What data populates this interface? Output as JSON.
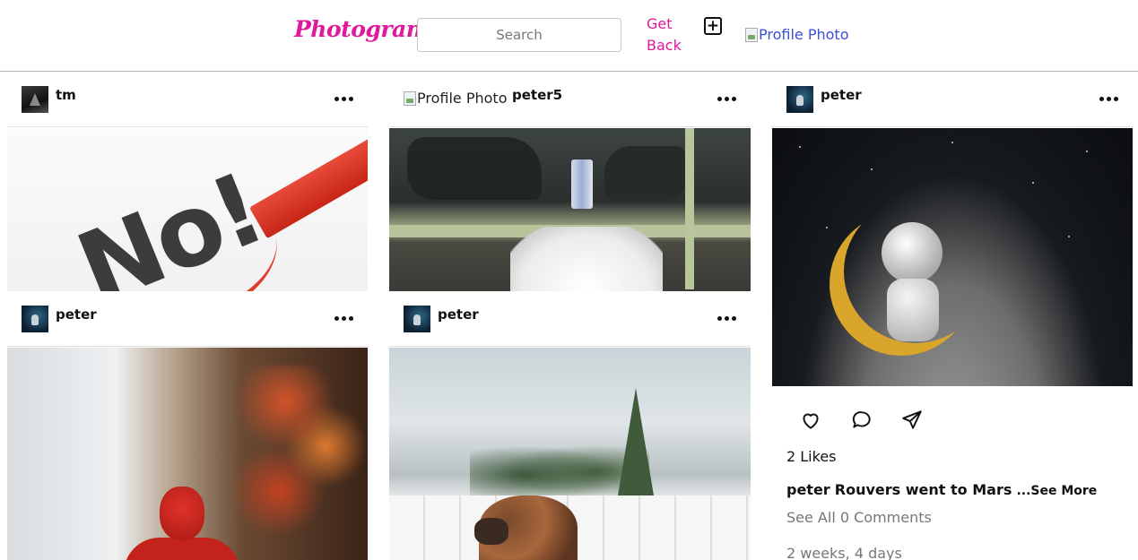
{
  "header": {
    "logo": "Photogram",
    "search_placeholder": "Search",
    "get_back_label": "Get Back",
    "add_icon": "plus-square-icon",
    "profile_alt": "Profile Photo"
  },
  "posts": [
    {
      "username": "tm",
      "avatar": "tm-avatar",
      "image": "no-pencil-image"
    },
    {
      "username": "peter5",
      "avatar_alt": "Profile Photo",
      "image": "garage-dog-image"
    },
    {
      "username": "peter",
      "avatar": "peter-avatar",
      "image": "astronaut-moon-image",
      "likes": "2 Likes",
      "caption_user": "peter",
      "caption_text": "Rouvers went to Mars",
      "see_more": "...See More",
      "comments": "See All 0 Comments",
      "time": "2 weeks, 4 days"
    },
    {
      "username": "peter",
      "avatar": "peter-avatar",
      "image": "spiderman-figure-image"
    },
    {
      "username": "peter",
      "avatar": "peter-avatar",
      "image": "boxer-dog-image"
    }
  ],
  "colors": {
    "brand": "#e0189a",
    "link": "#3b4fd8",
    "muted": "#777777",
    "divider": "#b5b5b5"
  }
}
